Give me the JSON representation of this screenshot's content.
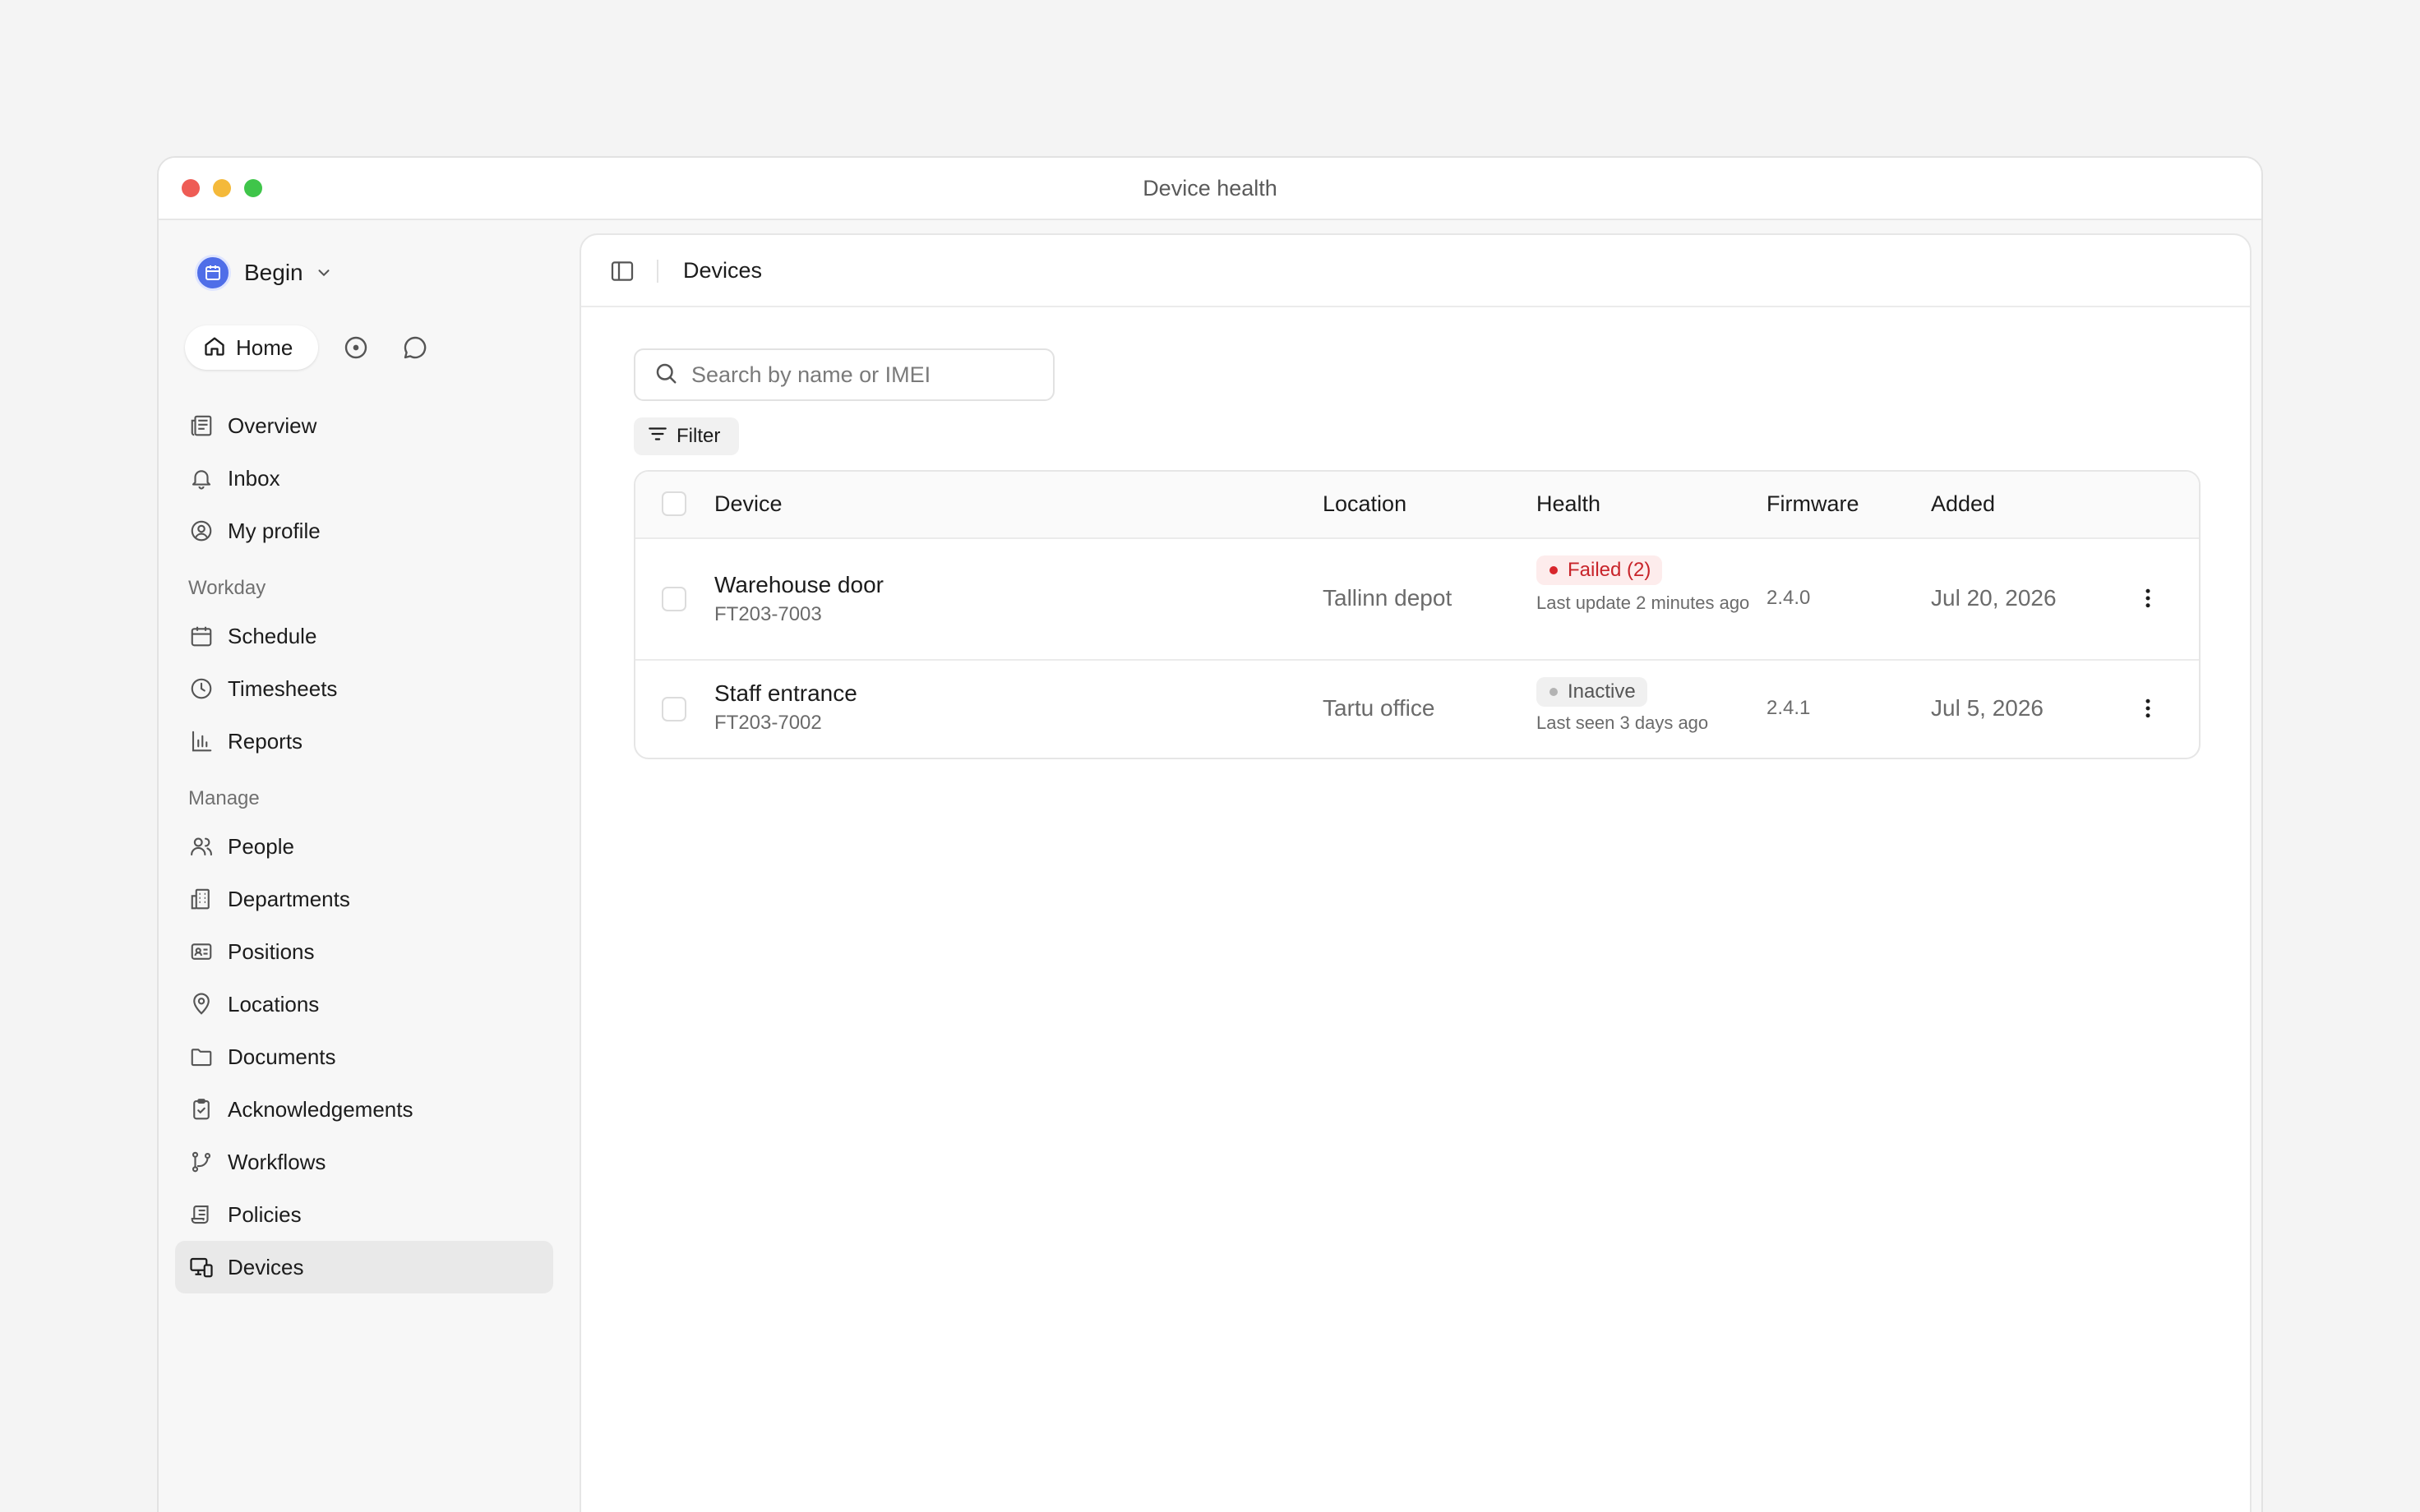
{
  "window": {
    "title": "Device health"
  },
  "workspace": {
    "name": "Begin"
  },
  "quickbar": {
    "home_label": "Home"
  },
  "sidebar": {
    "top_items": [
      {
        "label": "Overview",
        "icon": "newspaper-icon"
      },
      {
        "label": "Inbox",
        "icon": "bell-icon"
      },
      {
        "label": "My profile",
        "icon": "user-circle-icon"
      }
    ],
    "sections": [
      {
        "title": "Workday",
        "items": [
          {
            "label": "Schedule",
            "icon": "calendar-icon"
          },
          {
            "label": "Timesheets",
            "icon": "clock-icon"
          },
          {
            "label": "Reports",
            "icon": "bar-chart-icon"
          }
        ]
      },
      {
        "title": "Manage",
        "items": [
          {
            "label": "People",
            "icon": "users-icon"
          },
          {
            "label": "Departments",
            "icon": "building-icon"
          },
          {
            "label": "Positions",
            "icon": "id-card-icon"
          },
          {
            "label": "Locations",
            "icon": "map-pin-icon"
          },
          {
            "label": "Documents",
            "icon": "folder-icon"
          },
          {
            "label": "Acknowledgements",
            "icon": "clipboard-check-icon"
          },
          {
            "label": "Workflows",
            "icon": "git-branch-icon"
          },
          {
            "label": "Policies",
            "icon": "scroll-icon"
          },
          {
            "label": "Devices",
            "icon": "devices-icon",
            "active": true
          }
        ]
      }
    ]
  },
  "main": {
    "header_title": "Devices",
    "search": {
      "placeholder": "Search by name or IMEI",
      "value": ""
    },
    "filter_label": "Filter",
    "table": {
      "columns": [
        "Device",
        "Location",
        "Health",
        "Firmware",
        "Added"
      ],
      "rows": [
        {
          "name": "Warehouse door",
          "id": "FT203-7003",
          "location": "Tallinn depot",
          "health_status": "Failed (2)",
          "health_detail": "Last update 2 minutes ago",
          "firmware": "2.4.0",
          "added": "Jul 20, 2026"
        },
        {
          "name": "Staff entrance",
          "id": "FT203-7002",
          "location": "Tartu office",
          "health_status": "Inactive",
          "health_detail": "Last seen 3 days ago",
          "firmware": "2.4.1",
          "added": "Jul 5, 2026"
        }
      ]
    }
  },
  "colors": {
    "accent": "#4f6ee8",
    "failed": "#c8242a",
    "inactive": "#555555"
  }
}
